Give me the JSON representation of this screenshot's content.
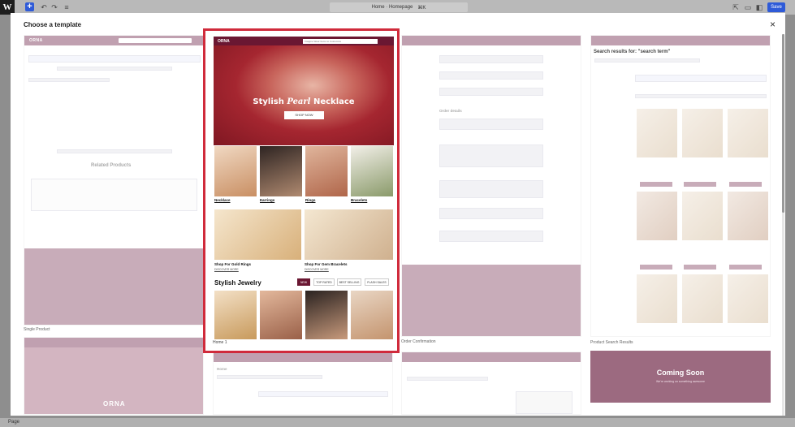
{
  "editor": {
    "doc_title": "Home · Homepage",
    "shortcut": "⌘K",
    "save_label": "Save",
    "bottom_status": "Page"
  },
  "modal": {
    "title": "Choose a template",
    "close_label": "×"
  },
  "templates": {
    "single_product": {
      "label": "Single Product",
      "related_heading": "Related Products"
    },
    "home": {
      "label": "Home 1"
    },
    "order_confirmation": {
      "label": "Order Confirmation",
      "order_details": "Order details"
    },
    "product_search_results": {
      "label": "Product Search Results",
      "heading": "Search results for: \"search term\""
    },
    "coming_soon": {
      "title": "Coming Soon",
      "subtitle": "We're working on something awesome"
    },
    "page_home": {
      "title": "Home"
    },
    "orna_logo": "ORNA"
  },
  "featured": {
    "logo": "ORNA",
    "search_placeholder": "Imagine Wear Items to Customize",
    "hero_title_pre": "Stylish ",
    "hero_title_em": "Pearl",
    "hero_title_post": " Necklace",
    "hero_button": "SHOP NOW",
    "categories": [
      "Necklace",
      "Earrings",
      "Rings",
      "Bracelets"
    ],
    "promos": [
      {
        "title": "Shop For Gold Rings",
        "link": "DISCOVER MORE"
      },
      {
        "title": "Shop For Gem Bracelets",
        "link": "DISCOVER MORE"
      }
    ],
    "section_title": "Stylish Jewelry",
    "tabs": [
      "NEW",
      "TOP RATED",
      "BEST SELLING",
      "FLASH SALES"
    ]
  },
  "colors": {
    "accent": "#d02a3b",
    "brand": "#6a1732",
    "mauve": "#9c6a80",
    "wp_blue": "#2f5bd8"
  }
}
